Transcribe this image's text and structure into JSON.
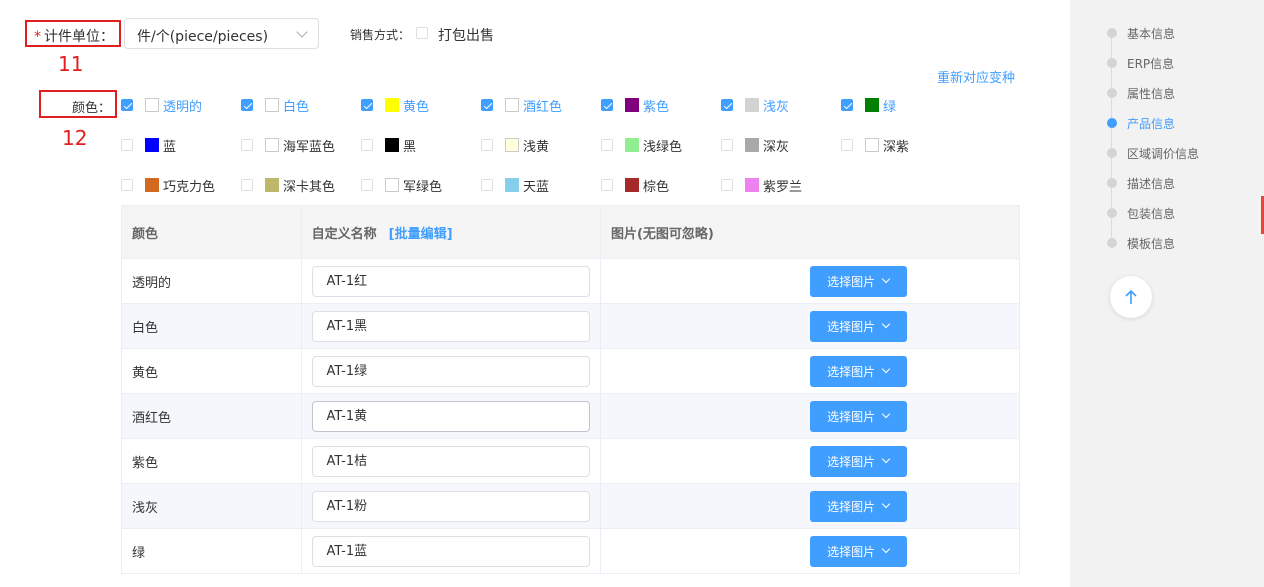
{
  "unit": {
    "required_mark": "*",
    "label": "计件单位：",
    "value": "件/个(piece/pieces)"
  },
  "sale": {
    "label": "销售方式：",
    "option": "打包出售",
    "checked": false
  },
  "annotations": {
    "a11": "11",
    "a12": "12"
  },
  "regen_link": "重新对应变种",
  "color_label": "颜色：",
  "color_options": [
    {
      "name": "透明的",
      "checked": true,
      "swatch": "#ffffff"
    },
    {
      "name": "白色",
      "checked": true,
      "swatch": "#ffffff"
    },
    {
      "name": "黄色",
      "checked": true,
      "swatch": "#ffff00"
    },
    {
      "name": "酒红色",
      "checked": true,
      "swatch": "#ffffff"
    },
    {
      "name": "紫色",
      "checked": true,
      "swatch": "#800080"
    },
    {
      "name": "浅灰",
      "checked": true,
      "swatch": "#d3d3d3"
    },
    {
      "name": "绿",
      "checked": true,
      "swatch": "#008000"
    },
    {
      "name": "蓝",
      "checked": false,
      "swatch": "#0000ff"
    },
    {
      "name": "海军蓝色",
      "checked": false,
      "swatch": "#ffffff"
    },
    {
      "name": "黑",
      "checked": false,
      "swatch": "#000000"
    },
    {
      "name": "浅黄",
      "checked": false,
      "swatch": "#ffffe0"
    },
    {
      "name": "浅绿色",
      "checked": false,
      "swatch": "#90ee90"
    },
    {
      "name": "深灰",
      "checked": false,
      "swatch": "#a9a9a9"
    },
    {
      "name": "深紫",
      "checked": false,
      "swatch": "#ffffff"
    },
    {
      "name": "巧克力色",
      "checked": false,
      "swatch": "#d2691e"
    },
    {
      "name": "深卡其色",
      "checked": false,
      "swatch": "#bdb76b"
    },
    {
      "name": "军绿色",
      "checked": false,
      "swatch": "#ffffff"
    },
    {
      "name": "天蓝",
      "checked": false,
      "swatch": "#87ceeb"
    },
    {
      "name": "棕色",
      "checked": false,
      "swatch": "#a52a2a"
    },
    {
      "name": "紫罗兰",
      "checked": false,
      "swatch": "#ee82ee"
    }
  ],
  "table": {
    "headers": {
      "color": "颜色",
      "custom": "自定义名称",
      "batch": "[批量编辑]",
      "image": "图片(无图可忽略)"
    },
    "rows": [
      {
        "color": "透明的",
        "custom": "AT-1红",
        "button": "选择图片"
      },
      {
        "color": "白色",
        "custom": "AT-1黑",
        "button": "选择图片"
      },
      {
        "color": "黄色",
        "custom": "AT-1绿",
        "button": "选择图片"
      },
      {
        "color": "酒红色",
        "custom": "AT-1黄",
        "button": "选择图片"
      },
      {
        "color": "紫色",
        "custom": "AT-1桔",
        "button": "选择图片"
      },
      {
        "color": "浅灰",
        "custom": "AT-1粉",
        "button": "选择图片"
      },
      {
        "color": "绿",
        "custom": "AT-1蓝",
        "button": "选择图片"
      }
    ]
  },
  "steps": [
    {
      "label": "基本信息",
      "active": false
    },
    {
      "label": "ERP信息",
      "active": false
    },
    {
      "label": "属性信息",
      "active": false
    },
    {
      "label": "产品信息",
      "active": true
    },
    {
      "label": "区域调价信息",
      "active": false
    },
    {
      "label": "描述信息",
      "active": false
    },
    {
      "label": "包装信息",
      "active": false
    },
    {
      "label": "模板信息",
      "active": false
    }
  ],
  "back_top_icon": "arrow-up-icon",
  "accent_color": "#409eff"
}
